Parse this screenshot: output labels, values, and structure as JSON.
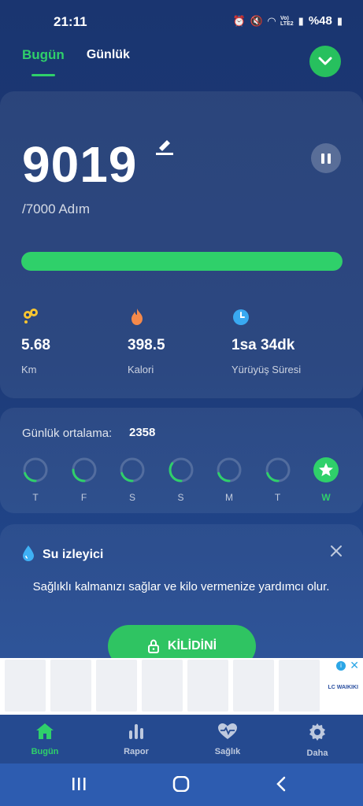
{
  "status_bar": {
    "time": "21:11",
    "network": "Vo)\nLTE2",
    "battery": "%48"
  },
  "tabs": [
    {
      "label": "Bugün",
      "active": true
    },
    {
      "label": "Günlük",
      "active": false
    }
  ],
  "steps": {
    "value": "9019",
    "goal": "/7000 Adım",
    "progress_fraction": 1.0
  },
  "stats": [
    {
      "icon": "footprints-icon",
      "value": "5.68",
      "label": "Km",
      "color": "#f7c531"
    },
    {
      "icon": "flame-icon",
      "value": "398.5",
      "label": "Kalori",
      "color": "#f5894a"
    },
    {
      "icon": "clock-icon",
      "value": "1sa 34dk",
      "label": "Yürüyüş Süresi",
      "color": "#39a9f1"
    }
  ],
  "weekly": {
    "avg_label": "Günlük ortalama:",
    "avg_value": "2358",
    "days": [
      {
        "label": "T",
        "progress": 0.2
      },
      {
        "label": "F",
        "progress": 0.25
      },
      {
        "label": "S",
        "progress": 0.2
      },
      {
        "label": "S",
        "progress": 0.35
      },
      {
        "label": "M",
        "progress": 0.2
      },
      {
        "label": "T",
        "progress": 0.2
      },
      {
        "label": "W",
        "progress": 1.0,
        "today": true
      }
    ]
  },
  "water": {
    "title": "Su izleyici",
    "description": "Sağlıklı kalmanızı sağlar ve kilo vermenize yardımcı olur.",
    "unlock_label": "KİLİDİNİ"
  },
  "ad": {
    "brand": "LC WAIKIKI"
  },
  "bottom_nav": [
    {
      "label": "Bugün",
      "icon": "home-icon",
      "active": true
    },
    {
      "label": "Rapor",
      "icon": "bar-chart-icon",
      "active": false
    },
    {
      "label": "Sağlık",
      "icon": "heart-pulse-icon",
      "active": false
    },
    {
      "label": "Daha",
      "icon": "gear-icon",
      "active": false
    }
  ],
  "colors": {
    "accent": "#2fd06a",
    "background": "#1d3b78"
  }
}
